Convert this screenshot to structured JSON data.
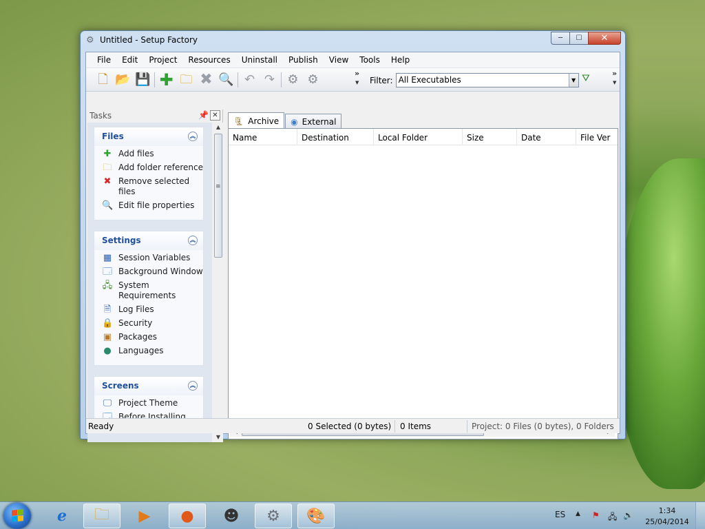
{
  "window": {
    "title": "Untitled - Setup Factory",
    "min_glyph": "─",
    "max_glyph": "☐",
    "close_glyph": "✕"
  },
  "menu": [
    "File",
    "Edit",
    "Project",
    "Resources",
    "Uninstall",
    "Publish",
    "View",
    "Tools",
    "Help"
  ],
  "toolbar": {
    "more_glyph": "»",
    "filter_label": "Filter:",
    "filter_value": "All Executables"
  },
  "tasks": {
    "title": "Tasks",
    "groups": [
      {
        "title": "Files",
        "items": [
          "Add files",
          "Add folder reference",
          "Remove selected files",
          "Edit file properties"
        ]
      },
      {
        "title": "Settings",
        "items": [
          "Session Variables",
          "Background Window",
          "System Requirements",
          "Log Files",
          "Security",
          "Packages",
          "Languages"
        ]
      },
      {
        "title": "Screens",
        "items": [
          "Project Theme",
          "Before Installing"
        ]
      }
    ]
  },
  "tabs": [
    "Archive",
    "External"
  ],
  "columns": [
    "Name",
    "Destination",
    "Local Folder",
    "Size",
    "Date",
    "File Ver"
  ],
  "status": {
    "ready": "Ready",
    "selected": "0 Selected (0 bytes)",
    "items": "0 Items",
    "project": "Project: 0 Files (0 bytes), 0 Folders"
  },
  "taskbar": {
    "lang": "ES",
    "time": "1:34",
    "date": "25/04/2014"
  },
  "colors": {
    "group_title": "#1f4f9e",
    "close_button": "#c7402a"
  }
}
